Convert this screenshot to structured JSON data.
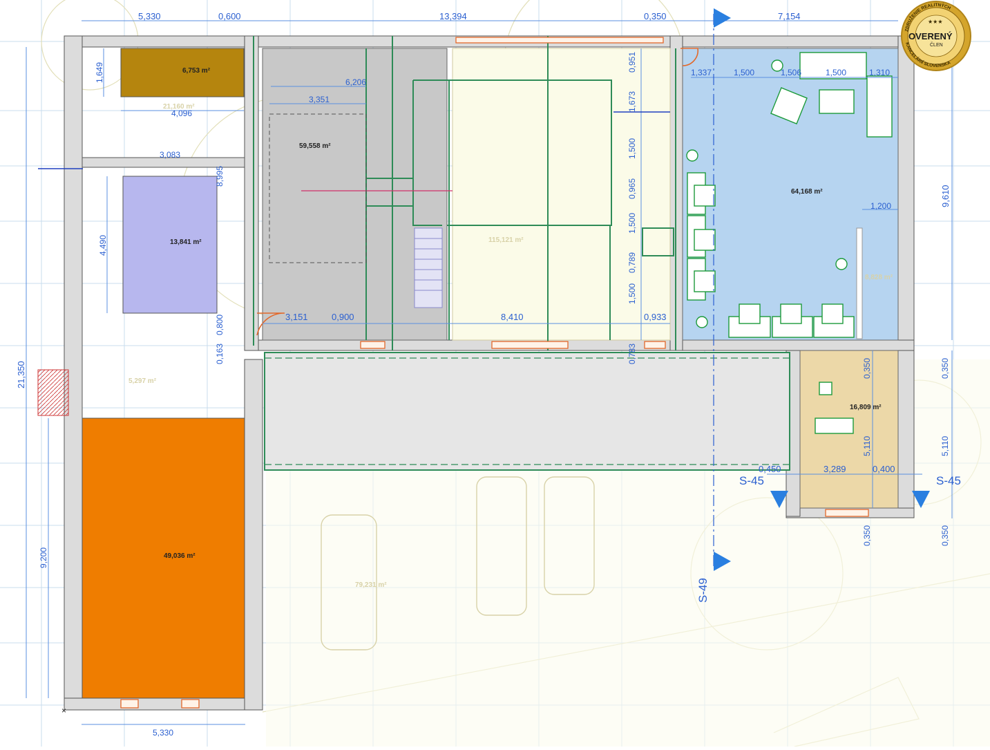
{
  "rooms": {
    "storage_small": "6,753 m²",
    "bathroom": "13,841 m²",
    "garage_left": "49,036 m²",
    "hall": "59,558 m²",
    "office": "64,168 m²",
    "side_office": "16,809 m²",
    "central": "115,121 m²",
    "carport": "79,231 m²",
    "ghost_storage": "21,160 m²",
    "ghost_corridor": "5,297 m²",
    "ghost_stair": "8,828 m²"
  },
  "dims_top": {
    "d1": "5,330",
    "d2": "0,600",
    "d3": "13,394",
    "d4": "0,350",
    "d5": "7,154"
  },
  "dims_bottom": {
    "d1": "5,330"
  },
  "dims_left": {
    "total": "21,350",
    "lower": "9,200",
    "upper": "1,649",
    "mid": "4,490"
  },
  "dims_right": {
    "total": "9,610",
    "r1": "0,350",
    "r2": "5,110",
    "r3": "0,350"
  },
  "dims_inner": {
    "a": "6,206",
    "b": "3,351",
    "c": "4,096",
    "d": "3,083",
    "e": "8,995",
    "f": "3,151",
    "g": "0,900",
    "h": "8,410",
    "i": "0,933",
    "j": "0,800",
    "k": "0,163",
    "l": "0,783",
    "m": "0,951",
    "n": "1,673",
    "o": "1,500",
    "p": "0,965",
    "q": "1,500",
    "r": "0,789",
    "s": "1,500",
    "t": "1,337",
    "u": "1,500",
    "v": "1,506",
    "w": "1,500",
    "x": "1,310",
    "y": "1,200",
    "z1": "0,450",
    "z2": "3,289",
    "z3": "0,400",
    "z4": "0,350",
    "z5": "5,110",
    "z6": "0,350"
  },
  "sections": {
    "s45_left": "S-45",
    "s45_right": "S-45",
    "s49": "S-49"
  },
  "badge": {
    "top_text": "ZDRUŽENIE REALITNÝCH",
    "bottom_text": "KANCELÁRIÍ SLOVENSKA",
    "main": "OVERENÝ",
    "sub": "ČLEN",
    "color": "#d4a52c"
  },
  "colors": {
    "storage": "#b5850e",
    "bathroom": "#b7b7ee",
    "garage": "#ef7d00",
    "hall": "#c8c8c8",
    "office": "#b6d4f0",
    "side_office": "#ecd8a8",
    "corridor": "#e6e6e6"
  }
}
